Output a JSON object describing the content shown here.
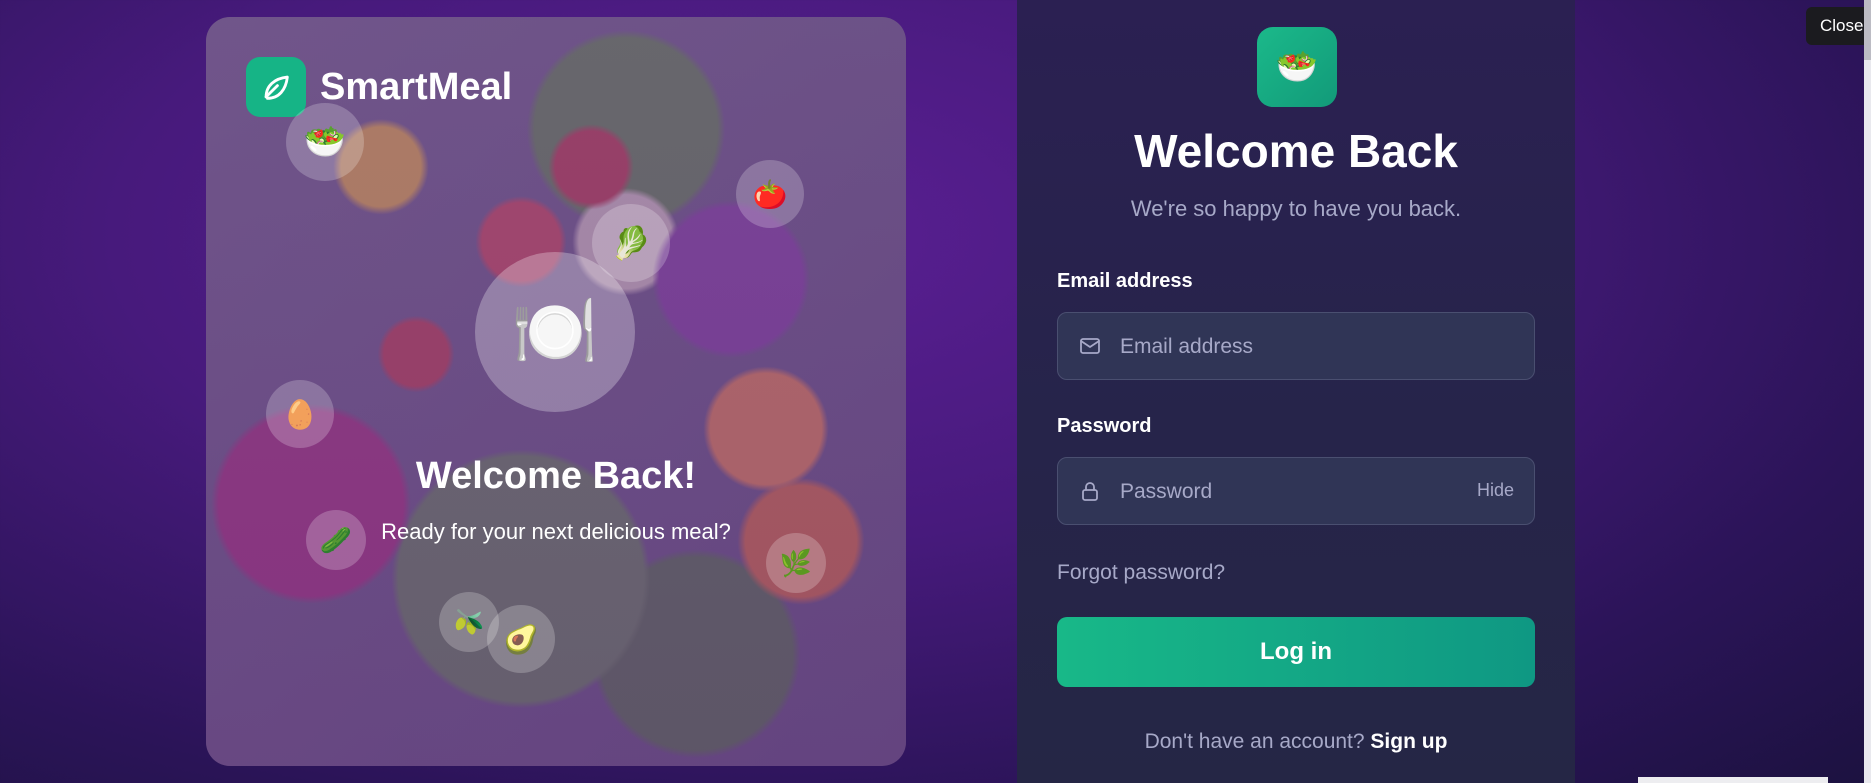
{
  "hero": {
    "brand_name": "SmartMeal",
    "title": "Welcome Back!",
    "subtitle": "Ready for your next delicious meal?",
    "bubbles": [
      "🥗",
      "🍅",
      "🥬",
      "🍽️",
      "🥚",
      "🥒",
      "🌿",
      "🫒",
      "🥑"
    ]
  },
  "panel": {
    "logo_emoji": "🥗",
    "title": "Welcome Back",
    "subtitle": "We're so happy to have you back.",
    "email": {
      "label": "Email address",
      "placeholder": "Email address",
      "value": ""
    },
    "password": {
      "label": "Password",
      "placeholder": "Password",
      "value": "",
      "toggle_label": "Hide"
    },
    "forgot_label": "Forgot password?",
    "login_label": "Log in",
    "signup_prompt": "Don't have an account?",
    "signup_label": "Sign up"
  },
  "tooltip": {
    "close_label": "Close"
  },
  "colors": {
    "accent": "#16b486",
    "background": "#471a7c",
    "panel": "#2b2052"
  }
}
